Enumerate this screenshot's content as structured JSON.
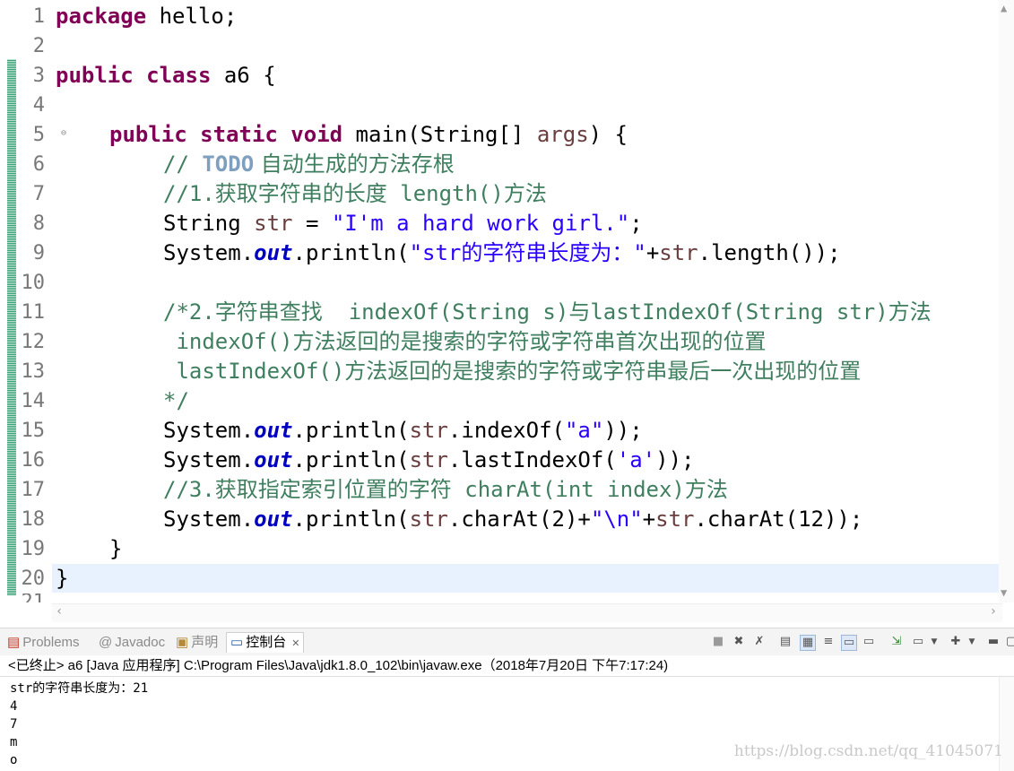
{
  "editor": {
    "line_numbers": [
      "1",
      "2",
      "3",
      "4",
      "5",
      "6",
      "7",
      "8",
      "9",
      "10",
      "11",
      "12",
      "13",
      "14",
      "15",
      "16",
      "17",
      "18",
      "19",
      "20",
      "21"
    ],
    "code": {
      "l1_kw": "package",
      "l1_rest": " hello;",
      "l3_kw": "public class",
      "l3_rest": " a6 {",
      "l5_kw": "public static void",
      "l5_rest1": " main(String[] ",
      "l5_var": "args",
      "l5_rest2": ") {",
      "l6_c1": "// ",
      "l6_todo": "TODO",
      "l6_c2": " 自动生成的方法存根",
      "l7": "//1.获取字符串的长度 length()方法",
      "l8_a": "String ",
      "l8_var": "str",
      "l8_b": " = ",
      "l8_str": "\"I'm a hard work girl.\"",
      "l8_c": ";",
      "sys": "System.",
      "out": "out",
      "l9_a": ".println(",
      "l9_str": "\"str的字符串长度为：\"",
      "l9_b": "+",
      "l9_var": "str",
      "l9_c": ".length());",
      "l11": "/*2.字符串查找  indexOf(String s)与lastIndexOf(String str)方法",
      "l12": " indexOf()方法返回的是搜索的字符或字符串首次出现的位置",
      "l13": " lastIndexOf()方法返回的是搜索的字符或字符串最后一次出现的位置",
      "l14": "*/",
      "l15_a": ".println(",
      "l15_var": "str",
      "l15_b": ".indexOf(",
      "l15_str": "\"a\"",
      "l15_c": "));",
      "l16_a": ".println(",
      "l16_var": "str",
      "l16_b": ".lastIndexOf(",
      "l16_str": "'a'",
      "l16_c": "));",
      "l17": "//3.获取指定索引位置的字符 charAt(int index)方法",
      "l18_a": ".println(",
      "l18_var": "str",
      "l18_b": ".charAt(2)+",
      "l18_str": "\"\\n\"",
      "l18_c": "+",
      "l18_var2": "str",
      "l18_d": ".charAt(12));",
      "l19": "}",
      "l20": "}"
    }
  },
  "console_panel": {
    "tabs": [
      {
        "label": "Problems",
        "icon": "problems-icon"
      },
      {
        "label": "Javadoc",
        "icon": "at-icon"
      },
      {
        "label": "声明",
        "icon": "declaration-icon"
      },
      {
        "label": "控制台",
        "icon": "console-icon"
      }
    ],
    "header": "<已终止> a6 [Java 应用程序] C:\\Program Files\\Java\\jdk1.8.0_102\\bin\\javaw.exe（2018年7月20日 下午7:17:24)",
    "output": [
      "str的字符串长度为：21",
      "4",
      "7",
      "m",
      "o"
    ]
  },
  "watermark": "https://blog.csdn.net/qq_41045071",
  "colors": {
    "keyword": "#7f0055",
    "string": "#2a00ff",
    "comment": "#3f7f5f",
    "field": "#0000c0",
    "local_var": "#6a3e3e",
    "current_line": "#e8f2fe"
  }
}
